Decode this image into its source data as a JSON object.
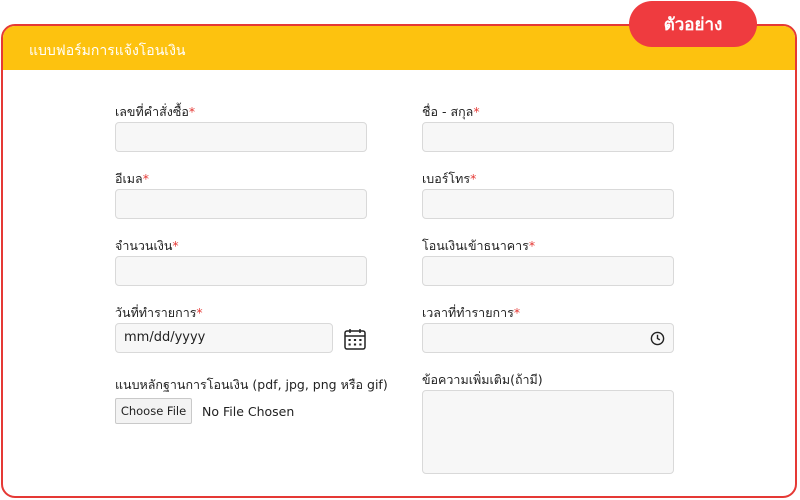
{
  "badge": "ตัวอย่าง",
  "form": {
    "title": "แบบฟอร์มการแจ้งโอนเงิน",
    "required_mark": "*",
    "fields": {
      "order_number": {
        "label": "เลขที่คำสั่งซื้อ",
        "value": ""
      },
      "full_name": {
        "label": "ชื่อ - สกุล",
        "value": ""
      },
      "email": {
        "label": "อีเมล",
        "value": ""
      },
      "phone": {
        "label": "เบอร์โทร",
        "value": ""
      },
      "amount": {
        "label": "จำนวนเงิน",
        "value": ""
      },
      "bank": {
        "label": "โอนเงินเข้าธนาคาร",
        "value": ""
      },
      "date": {
        "label": "วันที่ทำรายการ",
        "value": "mm/dd/yyyy"
      },
      "time": {
        "label": "เวลาที่ทำรายการ",
        "value": ""
      },
      "slip": {
        "label": "แนบหลักฐานการโอนเงิน (pdf, jpg, png หรือ gif)",
        "button": "Choose File",
        "status": "No File Chosen"
      },
      "note": {
        "label": "ข้อความเพิ่มเติม(ถ้ามี)",
        "value": ""
      }
    }
  },
  "icons": {
    "date": "calendar-icon",
    "time": "clock-icon"
  },
  "colors": {
    "header": "#fdc20f",
    "badge": "#ef3b3f",
    "border": "#e53935",
    "required": "#e53935",
    "input_bg": "#f7f7f7"
  }
}
